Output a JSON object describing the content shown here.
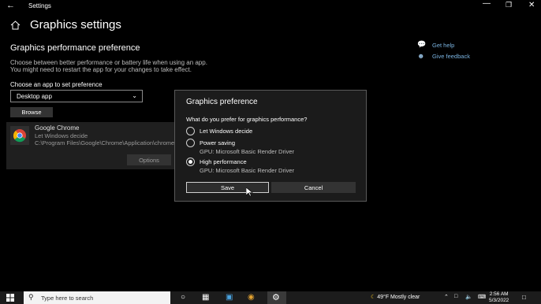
{
  "titlebar": {
    "back_icon": "back-arrow-icon",
    "title": "Settings",
    "minimize": "—",
    "maximize": "❐",
    "close": "✕"
  },
  "header": {
    "page_title": "Graphics settings",
    "home_icon": "home-icon"
  },
  "main": {
    "section_title": "Graphics performance preference",
    "description_line1": "Choose between better performance or battery life when using an app.",
    "description_line2": "You might need to restart the app for your changes to take effect.",
    "choose_label": "Choose an app to set preference",
    "dropdown_value": "Desktop app",
    "browse_label": "Browse",
    "app": {
      "name": "Google Chrome",
      "preference": "Let Windows decide",
      "path": "C:\\Program Files\\Google\\Chrome\\Application\\chrome.exe",
      "options_label": "Options"
    }
  },
  "side_links": {
    "help": "Get help",
    "feedback": "Give feedback"
  },
  "dialog": {
    "title": "Graphics preference",
    "question": "What do you prefer for graphics performance?",
    "options": [
      {
        "label": "Let Windows decide",
        "sub": "",
        "checked": false
      },
      {
        "label": "Power saving",
        "sub": "GPU: Microsoft Basic Render Driver",
        "checked": false
      },
      {
        "label": "High performance",
        "sub": "GPU: Microsoft Basic Render Driver",
        "checked": true
      }
    ],
    "save_label": "Save",
    "cancel_label": "Cancel"
  },
  "taskbar": {
    "search_placeholder": "Type here to search",
    "weather": "49°F  Mostly clear",
    "time": "2:56 AM",
    "date": "5/3/2022"
  },
  "colors": {
    "background": "#000000",
    "link": "#7ab3e0",
    "dialog_bg": "#1b1b1b"
  }
}
